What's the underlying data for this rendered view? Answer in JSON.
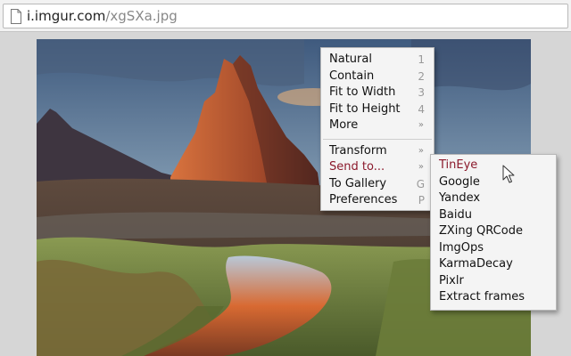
{
  "addressbar": {
    "url_host": "i.imgur.com",
    "url_path": "/xgSXa.jpg",
    "page_icon": "page-icon"
  },
  "context_menu": {
    "items": [
      {
        "label": "Natural",
        "key": "1"
      },
      {
        "label": "Contain",
        "key": "2"
      },
      {
        "label": "Fit to Width",
        "key": "3"
      },
      {
        "label": "Fit to Height",
        "key": "4"
      },
      {
        "label": "More",
        "key": "»"
      }
    ],
    "items2": [
      {
        "label": "Transform",
        "key": "»"
      },
      {
        "label": "Send to...",
        "key": "»"
      },
      {
        "label": "To Gallery",
        "key": "G"
      },
      {
        "label": "Preferences",
        "key": "P"
      }
    ]
  },
  "submenu": {
    "items": [
      "TinEye",
      "Google",
      "Yandex",
      "Baidu",
      "ZXing QRCode",
      "ImgOps",
      "KarmaDecay",
      "Pixlr",
      "Extract frames"
    ]
  },
  "colors": {
    "highlight": "#8b1a2c",
    "menu_bg": "#f4f4f4"
  }
}
